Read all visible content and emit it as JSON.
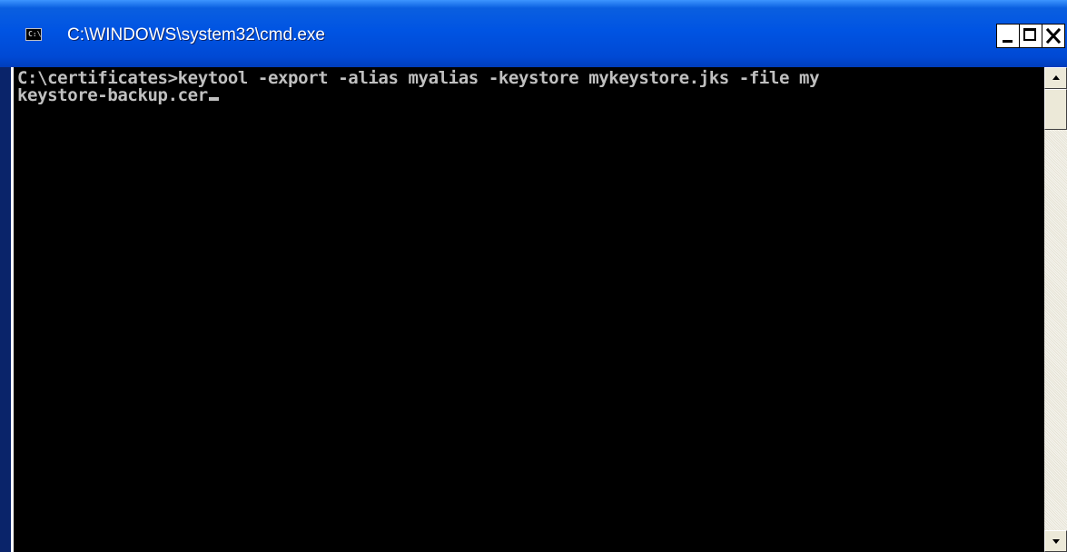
{
  "window": {
    "title": "C:\\WINDOWS\\system32\\cmd.exe",
    "icon": "console-icon",
    "controls": {
      "minimize_icon": "minimize-icon",
      "maximize_icon": "maximize-icon",
      "close_icon": "close-icon"
    }
  },
  "console": {
    "lines": [
      "C:\\certificates>keytool -export -alias myalias -keystore mykeystore.jks -file my",
      "keystore-backup.cer"
    ],
    "background_color": "#000000",
    "text_color": "#c0c0c0"
  },
  "scrollbar": {
    "up_icon": "scroll-up-arrow-icon",
    "down_icon": "scroll-down-arrow-icon"
  },
  "colors": {
    "titlebar": "#0054e3",
    "title_text": "#ffffff"
  }
}
